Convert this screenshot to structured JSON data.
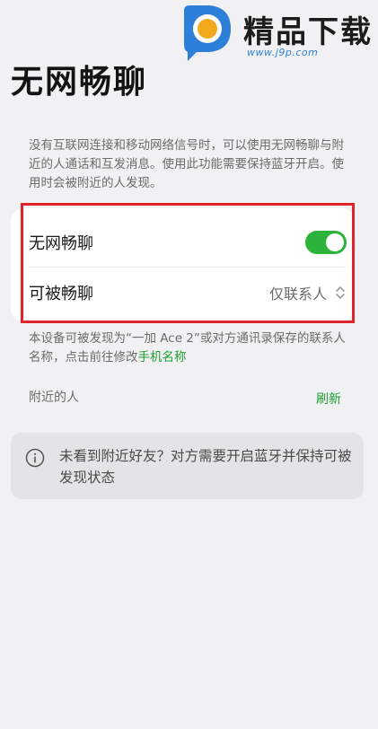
{
  "watermark": {
    "brand": "精品下载",
    "url": "www.j9p.com"
  },
  "page": {
    "title": "无网畅聊",
    "description": "没有互联网连接和移动网络信号时，可以使用无网畅聊与附近的人通话和互发消息。使用此功能需要保持蓝牙开启。使用时会被附近的人发现。"
  },
  "settings": {
    "toggle_label": "无网畅聊",
    "toggle_on": true,
    "discoverable_label": "可被畅聊",
    "discoverable_value": "仅联系人"
  },
  "hint": {
    "text": "本设备可被发现为“一加 Ace 2”或对方通讯录保存的联系人名称，点击前往修改",
    "link": "手机名称"
  },
  "nearby": {
    "label": "附近的人",
    "refresh": "刷新"
  },
  "info": {
    "text": "未看到附近好友？对方需要开启蓝牙并保持可被发现状态"
  },
  "colors": {
    "accent_green": "#2bb33b",
    "highlight_red": "#e0242a",
    "background": "#f1f1f3"
  }
}
